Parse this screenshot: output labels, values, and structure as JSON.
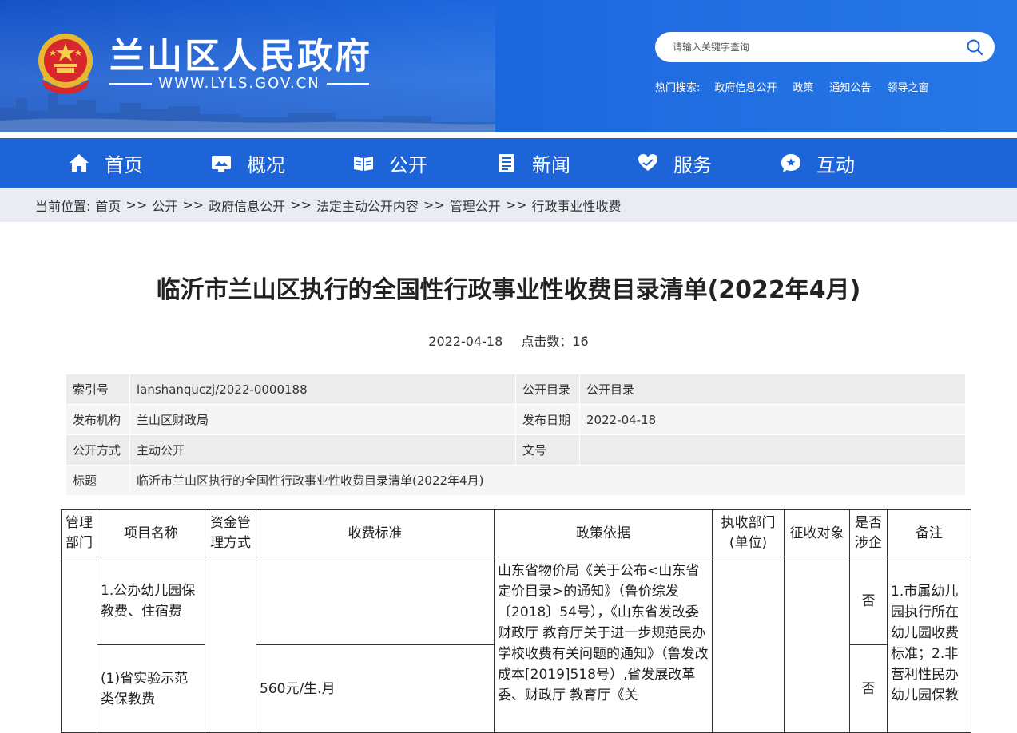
{
  "site": {
    "title": "兰山区人民政府",
    "url": "WWW.LYLS.GOV.CN"
  },
  "search": {
    "placeholder": "请输入关键字查询"
  },
  "hot": {
    "label": "热门搜索:",
    "links": [
      "政府信息公开",
      "政策",
      "通知公告",
      "领导之窗"
    ]
  },
  "nav": [
    {
      "label": "首页",
      "icon": "home-icon"
    },
    {
      "label": "概况",
      "icon": "overview-icon"
    },
    {
      "label": "公开",
      "icon": "open-book-icon"
    },
    {
      "label": "新闻",
      "icon": "news-icon"
    },
    {
      "label": "服务",
      "icon": "heart-hand-icon"
    },
    {
      "label": "互动",
      "icon": "chat-bubble-icon"
    }
  ],
  "breadcrumb": {
    "label": "当前位置:",
    "items": [
      "首页",
      "公开",
      "政府信息公开",
      "法定主动公开内容",
      "管理公开",
      "行政事业性收费"
    ],
    "sep": ">>"
  },
  "article": {
    "title": "临沂市兰山区执行的全国性行政事业性收费目录清单(2022年4月)",
    "date": "2022-04-18",
    "clicks": "点击数：16"
  },
  "info": {
    "index_key": "索引号",
    "index_val": "lanshanquczj/2022-0000188",
    "catalog_key": "公开目录",
    "catalog_val": "公开目录",
    "org_key": "发布机构",
    "org_val": "兰山区财政局",
    "date_key": "发布日期",
    "date_val": "2022-04-18",
    "mode_key": "公开方式",
    "mode_val": "主动公开",
    "doc_key": "文号",
    "doc_val": "",
    "title_key": "标题",
    "title_val": "临沂市兰山区执行的全国性行政事业性收费目录清单(2022年4月)"
  },
  "fees": {
    "headers": [
      "管理部门",
      "项目名称",
      "资金管理方式",
      "收费标准",
      "政策依据",
      "执收部门(单位)",
      "征收对象",
      "是否涉企",
      "备注"
    ],
    "row1": {
      "project": "1.公办幼儿园保教费、住宿费",
      "standard": "",
      "involve": "否"
    },
    "row2": {
      "project": "(1)省实验示范类保教费",
      "standard": "560元/生.月",
      "involve": "否"
    },
    "policy": "山东省物价局《关于公布<山东省定价目录>的通知》（鲁价综发〔2018〕54号），《山东省发改委 财政厅 教育厅关于进一步规范民办学校收费有关问题的通知》（鲁发改成本[2019]518号）,省发展改革委、财政厅 教育厅《关",
    "note": "1.市属幼儿园执行所在幼儿园收费标准；2.非营利性民办幼儿园保教"
  }
}
